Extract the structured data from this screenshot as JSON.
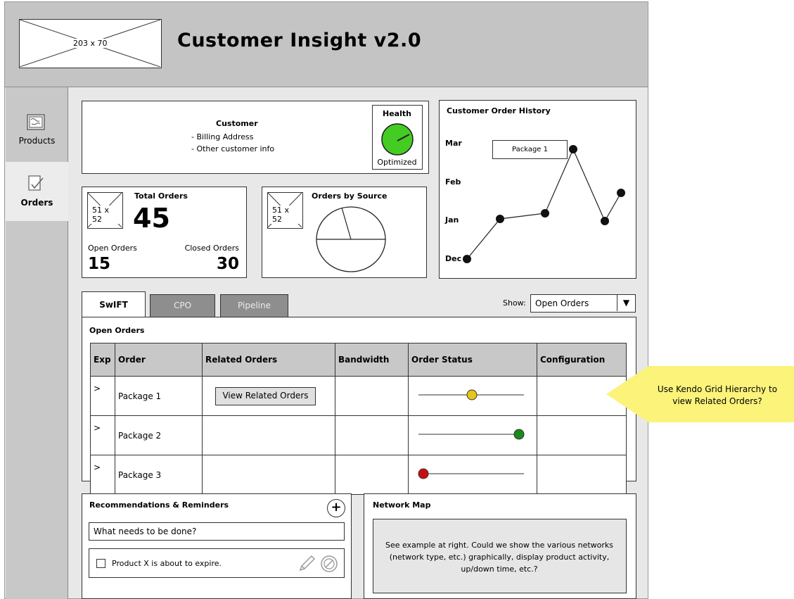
{
  "header": {
    "logo_placeholder": "203 x 70",
    "title": "Customer Insight v2.0"
  },
  "sidebar": {
    "items": [
      {
        "label": "Products",
        "icon": "map-icon"
      },
      {
        "label": "Orders",
        "icon": "checklist-icon"
      }
    ]
  },
  "customer_panel": {
    "title": "Customer",
    "lines": [
      "- Billing Address",
      "- Other customer info"
    ],
    "health": {
      "title": "Health",
      "status": "Optimized",
      "color": "#44cc22"
    }
  },
  "total_orders": {
    "placeholder": "51 x 52",
    "title": "Total Orders",
    "total": "45",
    "open_label": "Open Orders",
    "open_value": "15",
    "closed_label": "Closed Orders",
    "closed_value": "30"
  },
  "orders_by_source": {
    "placeholder": "51 x 52",
    "title": "Orders by Source"
  },
  "order_history": {
    "title": "Customer Order History",
    "y_labels": [
      "Mar",
      "Feb",
      "Jan",
      "Dec"
    ],
    "tooltip": "Package 1"
  },
  "tabs": [
    {
      "label": "SwIFT",
      "active": true
    },
    {
      "label": "CPO",
      "active": false
    },
    {
      "label": "Pipeline",
      "active": false
    }
  ],
  "show": {
    "label": "Show:",
    "value": "Open Orders"
  },
  "grid": {
    "title": "Open Orders",
    "columns": [
      "Exp",
      "Order",
      "Related Orders",
      "Bandwidth",
      "Order Status",
      "Configuration"
    ],
    "rows": [
      {
        "exp": ">",
        "order": "Package 1",
        "status_color": "#e6c619",
        "status_level": 0.5
      },
      {
        "exp": ">",
        "order": "Package 2",
        "status_color": "#1a8a1a",
        "status_level": 0.96
      },
      {
        "exp": ">",
        "order": "Package 3",
        "status_color": "#c81010",
        "status_level": 0.05
      }
    ],
    "related_button": "View Related Orders"
  },
  "callout": {
    "text": "Use Kendo Grid Hierarchy to view Related Orders?",
    "color": "#fbf37a"
  },
  "recommendations": {
    "title": "Recommendations & Reminders",
    "input_placeholder": "What needs to be done?",
    "item": "Product X is about to expire."
  },
  "network_map": {
    "title": "Network Map",
    "text": "See example at right. Could we show the various networks (network type, etc.) graphically, display product activity, up/down time, etc.?"
  }
}
